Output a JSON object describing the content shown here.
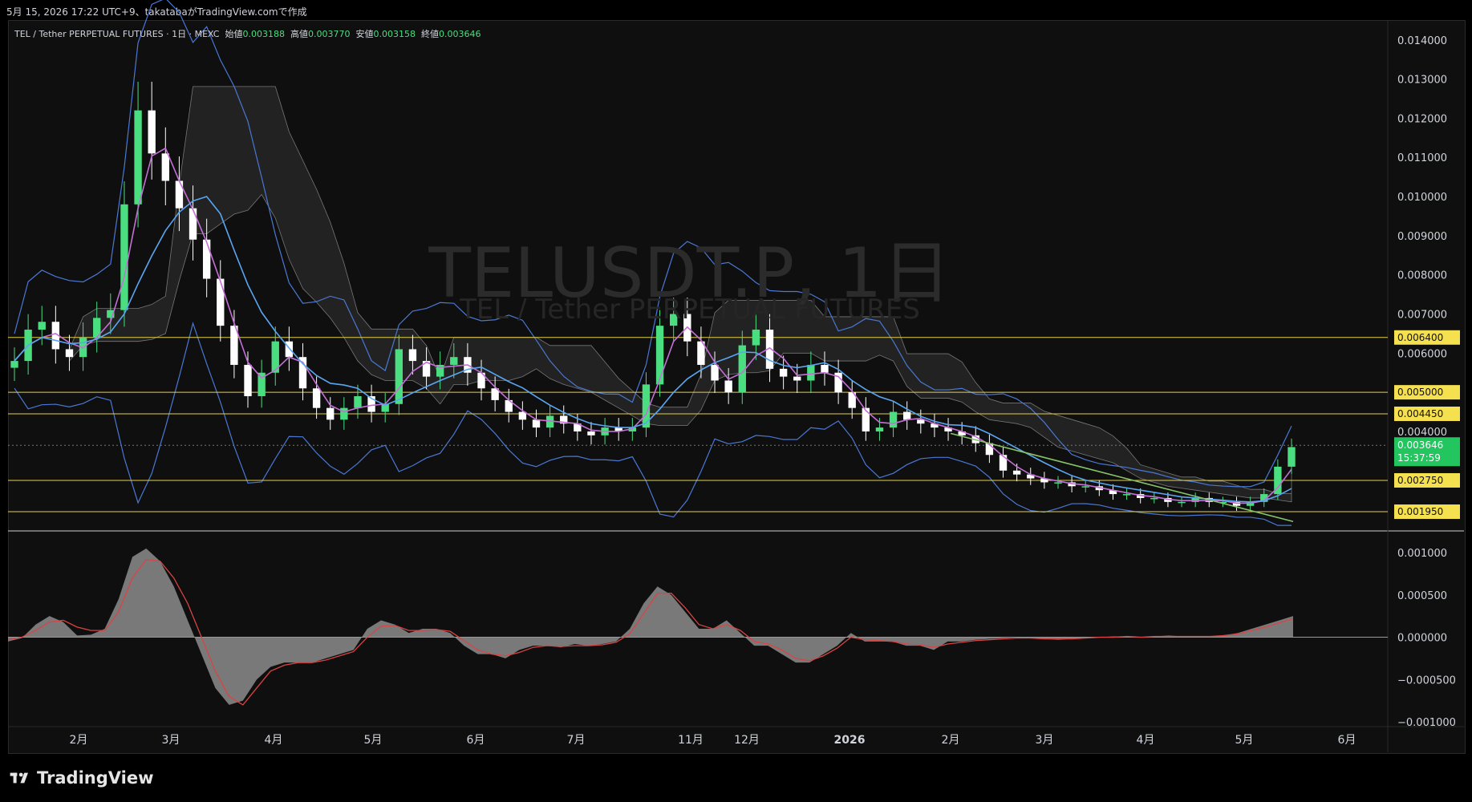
{
  "header": {
    "created_text": "5月 15, 2026 17:22 UTC+9、takatabaがTradingView.comで作成"
  },
  "legend": {
    "symbol": "TEL / Tether PERPETUAL FUTURES · 1日 · MEXC",
    "open_label": "始値",
    "open": "0.003188",
    "high_label": "高値",
    "high": "0.003770",
    "low_label": "安値",
    "low": "0.003158",
    "close_label": "終値",
    "close": "0.003646"
  },
  "watermark": {
    "title": "TELUSDT.P, 1日",
    "subtitle": "TEL / Tether PERPETUAL FUTURES"
  },
  "brand": {
    "name": "TradingView"
  },
  "colors": {
    "up": "#4ade80",
    "down": "#ffffff",
    "bollinger": "#4a78d4",
    "fast_ma": "#c46fd6",
    "slow_ma": "#5aa6f2",
    "level": "#e3cf4d",
    "trend": "#86c46a",
    "macd_signal": "#d94444",
    "macd_hist": "#8c8c8c",
    "label_bg": "#f5e04f",
    "price_label_bg": "#22c55e"
  },
  "chart_data": [
    {
      "type": "candlestick",
      "title": "TELUSDT.P, 1日",
      "interval": "1日",
      "exchange": "MEXC",
      "ylim": [
        0.0015,
        0.0142
      ],
      "y_ticks": [
        "0.014000",
        "0.013000",
        "0.012000",
        "0.011000",
        "0.010000",
        "0.009000",
        "0.008000",
        "0.007000",
        "0.006000",
        "0.004000"
      ],
      "x_ticks": [
        "2月",
        "3月",
        "4月",
        "5月",
        "6月",
        "7月",
        "11月",
        "12月",
        "2026",
        "2月",
        "3月",
        "4月",
        "5月",
        "6月"
      ],
      "horizontal_levels": [
        0.0064,
        0.005,
        0.00445,
        0.00275,
        0.00195
      ],
      "level_labels": [
        "0.006400",
        "0.005000",
        "0.004450",
        "0.002750",
        "0.001950"
      ],
      "last_price": {
        "value": 0.003646,
        "label": "0.003646",
        "countdown": "15:37:59"
      },
      "close_series": [
        0.0058,
        0.0066,
        0.0068,
        0.0061,
        0.0059,
        0.0064,
        0.0069,
        0.0071,
        0.0098,
        0.0122,
        0.0111,
        0.0104,
        0.0097,
        0.0089,
        0.0079,
        0.0067,
        0.0057,
        0.0049,
        0.0055,
        0.0063,
        0.0059,
        0.0051,
        0.0046,
        0.0043,
        0.0046,
        0.0049,
        0.0045,
        0.0047,
        0.0061,
        0.0058,
        0.0054,
        0.0057,
        0.0059,
        0.0055,
        0.0051,
        0.0048,
        0.0045,
        0.0043,
        0.0041,
        0.0044,
        0.0042,
        0.004,
        0.0039,
        0.0041,
        0.004,
        0.0041,
        0.0052,
        0.0067,
        0.007,
        0.0063,
        0.0057,
        0.0053,
        0.005,
        0.0062,
        0.0066,
        0.0056,
        0.0054,
        0.0053,
        0.0057,
        0.0055,
        0.005,
        0.0046,
        0.004,
        0.0041,
        0.0045,
        0.0043,
        0.0042,
        0.0041,
        0.004,
        0.0039,
        0.0037,
        0.0034,
        0.003,
        0.0029,
        0.0028,
        0.0027,
        0.0027,
        0.0026,
        0.0026,
        0.0025,
        0.0024,
        0.0024,
        0.0023,
        0.0023,
        0.0022,
        0.0022,
        0.0023,
        0.0022,
        0.0022,
        0.0021,
        0.0022,
        0.0024,
        0.0031,
        0.0036
      ]
    },
    {
      "type": "area",
      "title": "MACD",
      "ylim": [
        -0.001,
        0.0012
      ],
      "y_ticks": [
        "0.001000",
        "0.000500",
        "0.000000",
        "−0.000500",
        "−0.001000"
      ],
      "histogram": [
        -5e-05,
        -1e-05,
        0.00015,
        0.00025,
        0.00018,
        2e-05,
        3e-05,
        0.0001,
        0.00045,
        0.00095,
        0.00105,
        0.0009,
        0.0006,
        0.0002,
        -0.0002,
        -0.0006,
        -0.0008,
        -0.00075,
        -0.0005,
        -0.00035,
        -0.0003,
        -0.0003,
        -0.0003,
        -0.00025,
        -0.0002,
        -0.00015,
        0.0001,
        0.0002,
        0.00015,
        5e-05,
        0.0001,
        0.0001,
        5e-05,
        -0.0001,
        -0.0002,
        -0.0002,
        -0.00025,
        -0.00015,
        -0.0001,
        -0.0001,
        -0.00012,
        -8e-05,
        -0.0001,
        -8e-05,
        -5e-05,
        0.0001,
        0.0004,
        0.0006,
        0.0005,
        0.0003,
        0.0001,
        0.0001,
        0.0002,
        5e-05,
        -0.0001,
        -0.0001,
        -0.0002,
        -0.0003,
        -0.0003,
        -0.0002,
        -0.0001,
        5e-05,
        -5e-05,
        -5e-05,
        -5e-05,
        -0.0001,
        -0.0001,
        -0.00015,
        -5e-05,
        -5e-05,
        -3e-05,
        -2e-05,
        -1e-05,
        0.0,
        -1e-05,
        -2e-05,
        -3e-05,
        -2e-05,
        -1e-05,
        0.0,
        1e-05,
        1e-05,
        0.0,
        1e-05,
        2e-05,
        1e-05,
        0.0,
        1e-05,
        2e-05,
        5e-05,
        0.0001,
        0.00015,
        0.0002,
        0.00025
      ],
      "signal": [
        -3e-05,
        0.0,
        8e-05,
        0.00018,
        0.0002,
        0.00012,
        8e-05,
        8e-05,
        0.0003,
        0.0007,
        0.00092,
        0.0009,
        0.0007,
        0.0004,
        0.0,
        -0.0004,
        -0.0007,
        -0.0008,
        -0.0006,
        -0.0004,
        -0.00033,
        -0.0003,
        -0.0003,
        -0.00027,
        -0.00022,
        -0.00017,
        0.0,
        0.00013,
        0.00014,
        8e-05,
        8e-05,
        9e-05,
        7e-05,
        -4e-05,
        -0.00015,
        -0.0002,
        -0.00022,
        -0.00018,
        -0.00012,
        -0.0001,
        -0.00011,
        -0.0001,
        -0.0001,
        -9e-05,
        -6e-05,
        4e-05,
        0.00028,
        0.00052,
        0.00052,
        0.00035,
        0.00015,
        0.0001,
        0.00015,
        8e-05,
        -5e-05,
        -8e-05,
        -0.00015,
        -0.00025,
        -0.00028,
        -0.00022,
        -0.00013,
        0.0,
        -3e-05,
        -4e-05,
        -5e-05,
        -8e-05,
        -9e-05,
        -0.00012,
        -8e-05,
        -6e-05,
        -4e-05,
        -3e-05,
        -2e-05,
        -1e-05,
        -1e-05,
        -2e-05,
        -2e-05,
        -2e-05,
        -1e-05,
        0.0,
        0.0,
        1e-05,
        0.0,
        1e-05,
        1e-05,
        1e-05,
        1e-05,
        1e-05,
        2e-05,
        4e-05,
        8e-05,
        0.00012,
        0.00017,
        0.00022
      ]
    }
  ]
}
